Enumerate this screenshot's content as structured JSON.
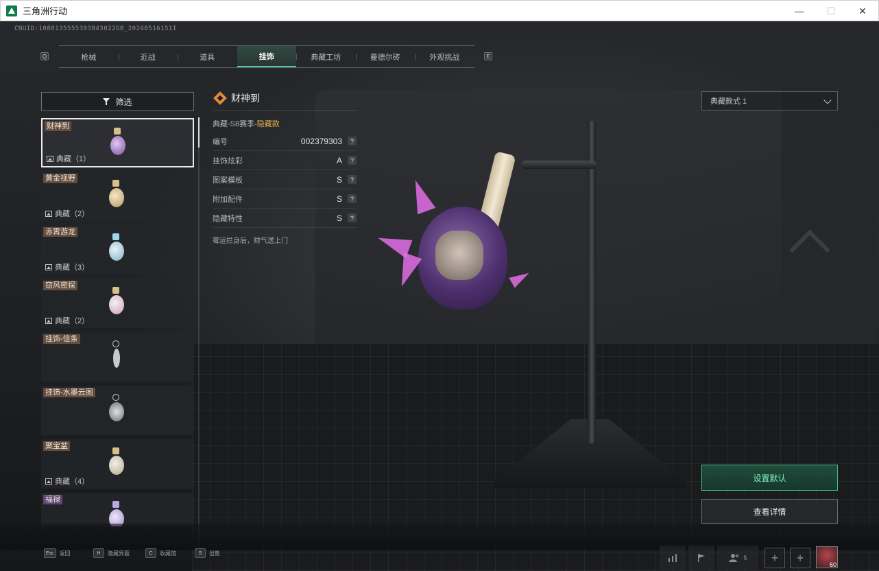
{
  "window": {
    "title": "三角洲行动",
    "controls": {
      "minimize": "—",
      "maximize": "☐",
      "close": "✕"
    }
  },
  "cnuid": "CNUID:1080135555393843022G8_20260516151I",
  "tabs": {
    "left_key": "Q",
    "right_key": "E",
    "items": [
      {
        "label": "枪械",
        "active": false
      },
      {
        "label": "近战",
        "active": false
      },
      {
        "label": "道具",
        "active": false
      },
      {
        "label": "挂饰",
        "active": true
      },
      {
        "label": "典藏工坊",
        "active": false
      },
      {
        "label": "曼德尔砖",
        "active": false
      },
      {
        "label": "外观挑战",
        "active": false
      }
    ]
  },
  "filter": {
    "label": "筛选"
  },
  "list": {
    "items": [
      {
        "name": "财神到",
        "foot": "典藏（1）",
        "selected": true
      },
      {
        "name": "黄金视野",
        "foot": "典藏（2）",
        "selected": false
      },
      {
        "name": "赤霄游龙",
        "foot": "典藏（3）",
        "selected": false
      },
      {
        "name": "窃风密探",
        "foot": "典藏（2）",
        "selected": false
      },
      {
        "name": "挂饰-信条",
        "foot": "",
        "selected": false
      },
      {
        "name": "挂饰-水墨云图",
        "foot": "",
        "selected": false
      },
      {
        "name": "聚宝盆",
        "foot": "典藏（4）",
        "selected": false
      },
      {
        "name": "福禄",
        "foot": "",
        "selected": false,
        "label_style": "purple"
      }
    ]
  },
  "detail": {
    "title": "财神到",
    "season_prefix": "典藏-S8赛季-",
    "season_highlight": "隐藏款",
    "rows": [
      {
        "label": "编号",
        "value": "002379303"
      },
      {
        "label": "挂饰炫彩",
        "value": "A"
      },
      {
        "label": "图案模板",
        "value": "S"
      },
      {
        "label": "附加配件",
        "value": "S"
      },
      {
        "label": "隐藏特性",
        "value": "S"
      }
    ],
    "help_glyph": "?",
    "description": "霉运拦身后，财气送上门"
  },
  "style_select": {
    "value": "典藏款式 1"
  },
  "actions": {
    "set_default": "设置默认",
    "view_details": "查看详情"
  },
  "bottom_hints": [
    {
      "key": "Esc",
      "label": "返回"
    },
    {
      "key": "H",
      "label": "隐藏界面"
    },
    {
      "key": "C",
      "label": "收藏馆"
    },
    {
      "key": "S",
      "label": "出售"
    }
  ],
  "hud": {
    "team_count": "5",
    "level": "60"
  }
}
